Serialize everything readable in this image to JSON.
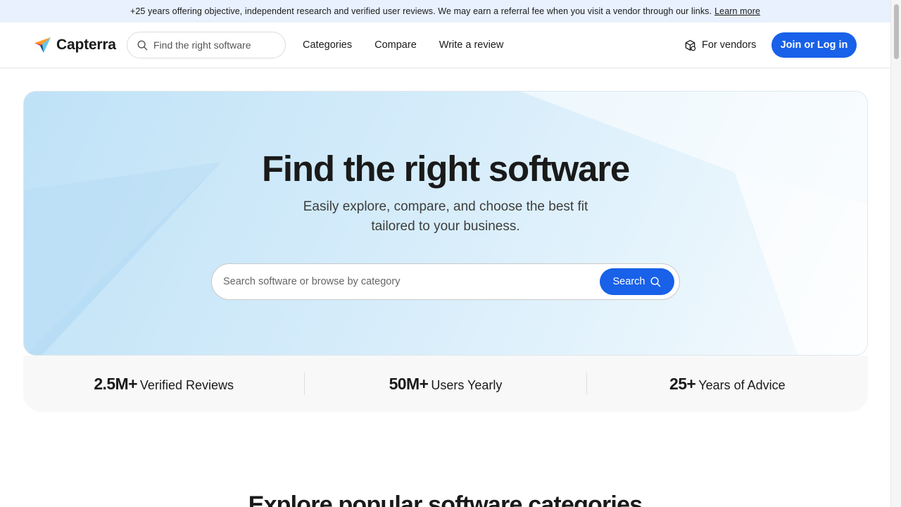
{
  "banner": {
    "text": "+25 years offering objective, independent research and verified user reviews. We may earn a referral fee when you visit a vendor through our links.",
    "link": "Learn more"
  },
  "header": {
    "logo_text": "Capterra",
    "search_placeholder": "Find the right software",
    "nav": [
      "Categories",
      "Compare",
      "Write a review"
    ],
    "vendors_label": "For vendors",
    "join_label": "Join or Log in"
  },
  "hero": {
    "title": "Find the right software",
    "subtitle_line1": "Easily explore, compare, and choose the best fit",
    "subtitle_line2": "tailored to your business.",
    "search_placeholder": "Search software or browse by category",
    "search_button": "Search"
  },
  "stats": [
    {
      "value": "2.5M+",
      "label": "Verified Reviews"
    },
    {
      "value": "50M+",
      "label": "Users Yearly"
    },
    {
      "value": "25+",
      "label": "Years of Advice"
    }
  ],
  "section": {
    "title": "Explore popular software categories"
  },
  "colors": {
    "accent": "#1861e8",
    "banner_bg": "#e8f1fd",
    "stats_bg": "#f8f8f8"
  },
  "icons": {
    "logo": "capterra-logo-icon",
    "search": "search-icon",
    "vendors": "vendor-box-icon"
  }
}
